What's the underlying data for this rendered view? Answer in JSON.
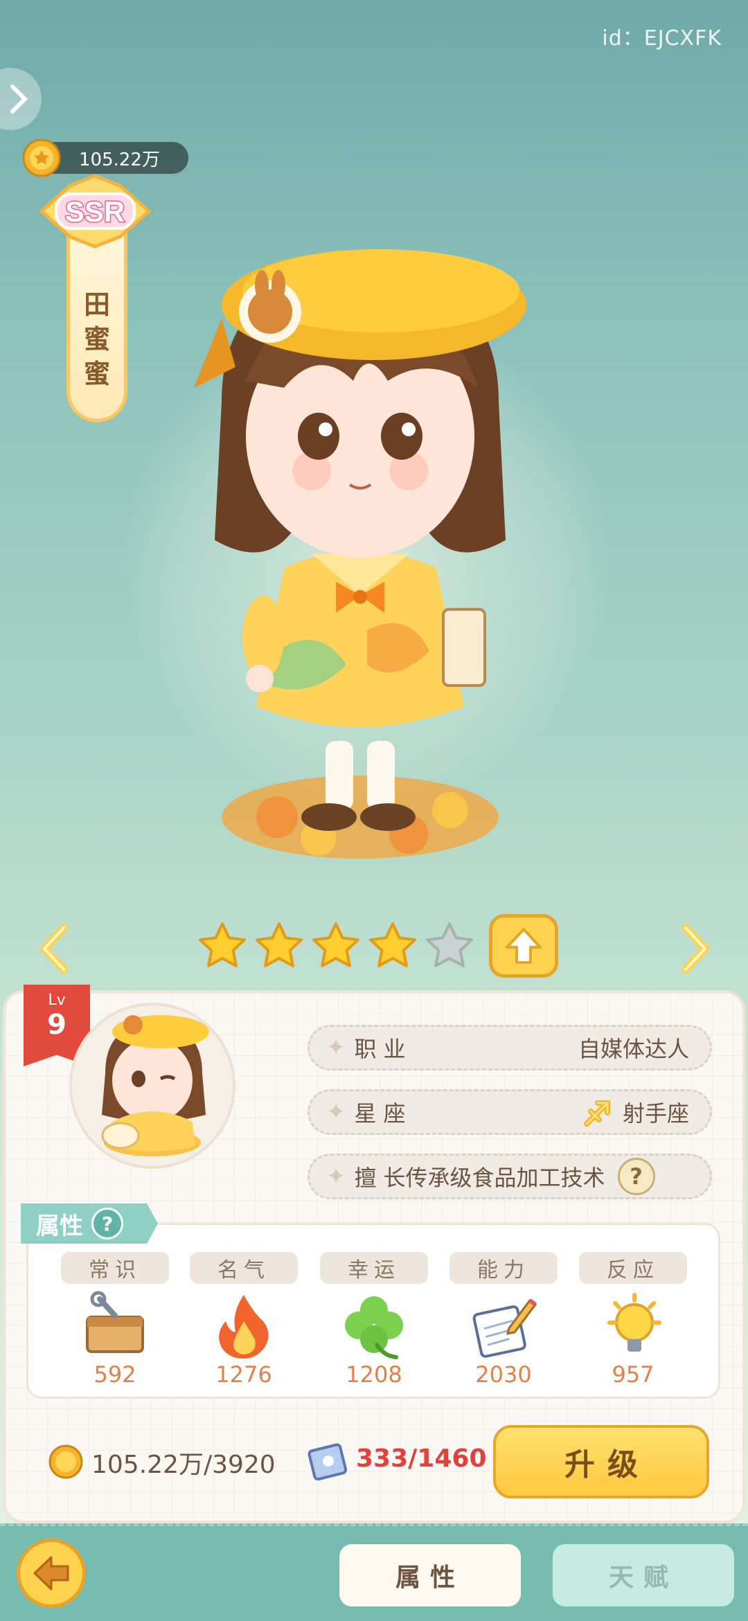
{
  "header": {
    "user_id": "id：EJCXFK",
    "coin_balance": "105.22万"
  },
  "character": {
    "rarity": "SSR",
    "name_chars": [
      "田",
      "蜜",
      "蜜"
    ],
    "stars_total": 5,
    "stars_filled": 4
  },
  "profile": {
    "level_label": "Lv",
    "level": "9",
    "job_label": "职业",
    "job_value": "自媒体达人",
    "sign_label": "星座",
    "sign_value": "射手座",
    "skill_label": "擅",
    "skill_value": "长传承级食品加工技术"
  },
  "attributes": {
    "title": "属性",
    "items": [
      {
        "name": "常识",
        "value": "592",
        "icon": "toolbox-icon"
      },
      {
        "name": "名气",
        "value": "1276",
        "icon": "fire-icon"
      },
      {
        "name": "幸运",
        "value": "1208",
        "icon": "clover-icon"
      },
      {
        "name": "能力",
        "value": "2030",
        "icon": "notebook-pencil-icon"
      },
      {
        "name": "反应",
        "value": "957",
        "icon": "lightbulb-icon"
      }
    ]
  },
  "upgrade": {
    "coin_cost": "105.22万/3920",
    "book_cost": "333/1460",
    "button_label": "升级"
  },
  "tabs": {
    "attributes": "属性",
    "talent": "天赋"
  },
  "colors": {
    "gold": "#ffd34d",
    "attr_value": "#e1814a",
    "insufficient": "#e2403a",
    "teal": "#76bcb1"
  }
}
